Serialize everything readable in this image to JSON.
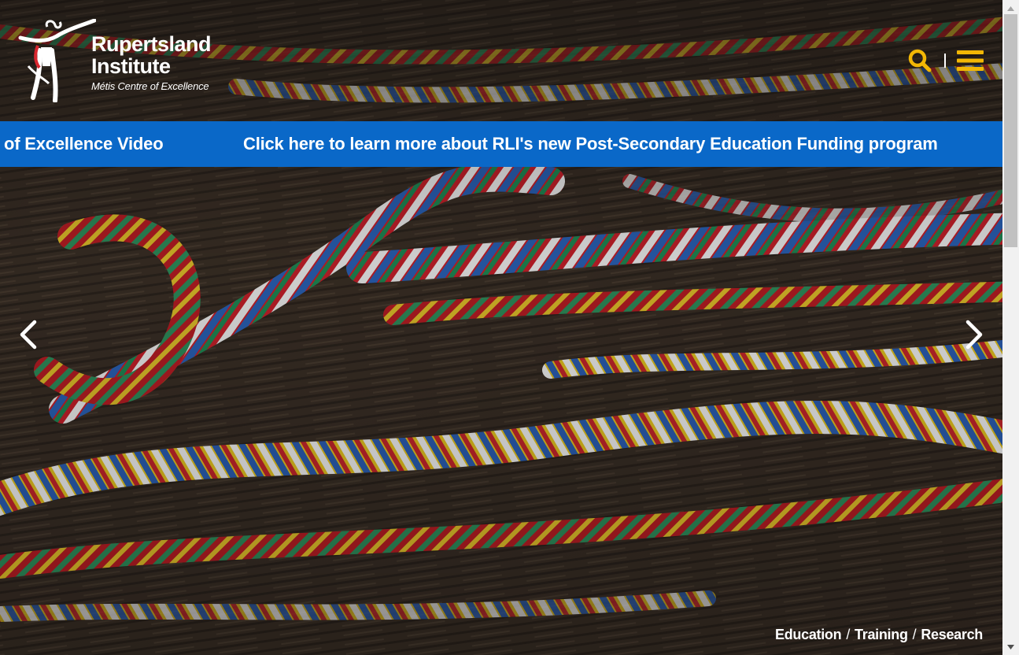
{
  "header": {
    "logo_name_line1": "Rupertsland",
    "logo_name_line2": "Institute",
    "logo_tagline": "Métis Centre of Excellence",
    "search_icon": "search-icon",
    "menu_icon": "hamburger-menu-icon",
    "accent_color": "#f2b705"
  },
  "ticker": {
    "background_color": "#0a68c8",
    "items": [
      "of Excellence Video",
      "Click here to learn more about RLI's new Post-Secondary Education Funding program"
    ]
  },
  "carousel": {
    "prev_icon": "chevron-left-icon",
    "next_icon": "chevron-right-icon"
  },
  "tagline": {
    "part1": "Education",
    "part2": "Training",
    "part3": "Research",
    "separator": "/"
  },
  "scrollbar": {
    "up_icon": "scroll-up-arrow-icon",
    "down_icon": "scroll-down-arrow-icon"
  }
}
